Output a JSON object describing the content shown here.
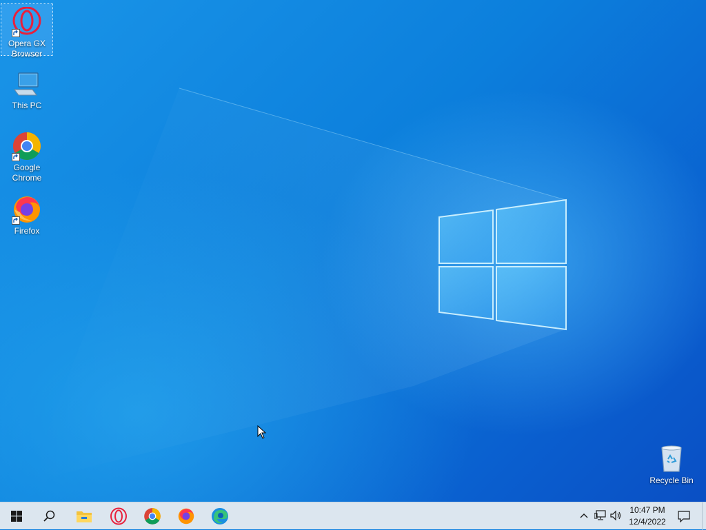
{
  "desktop": {
    "icons": [
      {
        "label_line1": "Opera GX",
        "label_line2": "Browser",
        "icon": "opera-gx-icon",
        "shortcut": true,
        "selected": true
      },
      {
        "label_line1": "This PC",
        "label_line2": "",
        "icon": "this-pc-icon",
        "shortcut": false,
        "selected": false
      },
      {
        "label_line1": "Google",
        "label_line2": "Chrome",
        "icon": "chrome-icon",
        "shortcut": true,
        "selected": false
      },
      {
        "label_line1": "Firefox",
        "label_line2": "",
        "icon": "firefox-icon",
        "shortcut": true,
        "selected": false
      },
      {
        "label_line1": "Recycle Bin",
        "label_line2": "",
        "icon": "recycle-bin-icon",
        "shortcut": false,
        "selected": false
      }
    ],
    "wallpaper": "windows-10-hero"
  },
  "taskbar": {
    "pinned": [
      {
        "name": "start",
        "icon": "windows-logo-icon"
      },
      {
        "name": "search",
        "icon": "search-icon"
      },
      {
        "name": "file-explorer",
        "icon": "folder-icon"
      },
      {
        "name": "opera-gx",
        "icon": "opera-gx-icon"
      },
      {
        "name": "chrome",
        "icon": "chrome-icon"
      },
      {
        "name": "firefox",
        "icon": "firefox-icon"
      },
      {
        "name": "edge",
        "icon": "edge-icon"
      }
    ],
    "tray": {
      "icons": [
        "chevron-up-icon",
        "network-icon",
        "volume-icon"
      ],
      "time": "10:47 PM",
      "date": "12/4/2022"
    }
  },
  "colors": {
    "taskbar_bg": "#dce6ef",
    "desktop_blue": "#0c7fdc",
    "opera_red": "#e8203c"
  }
}
